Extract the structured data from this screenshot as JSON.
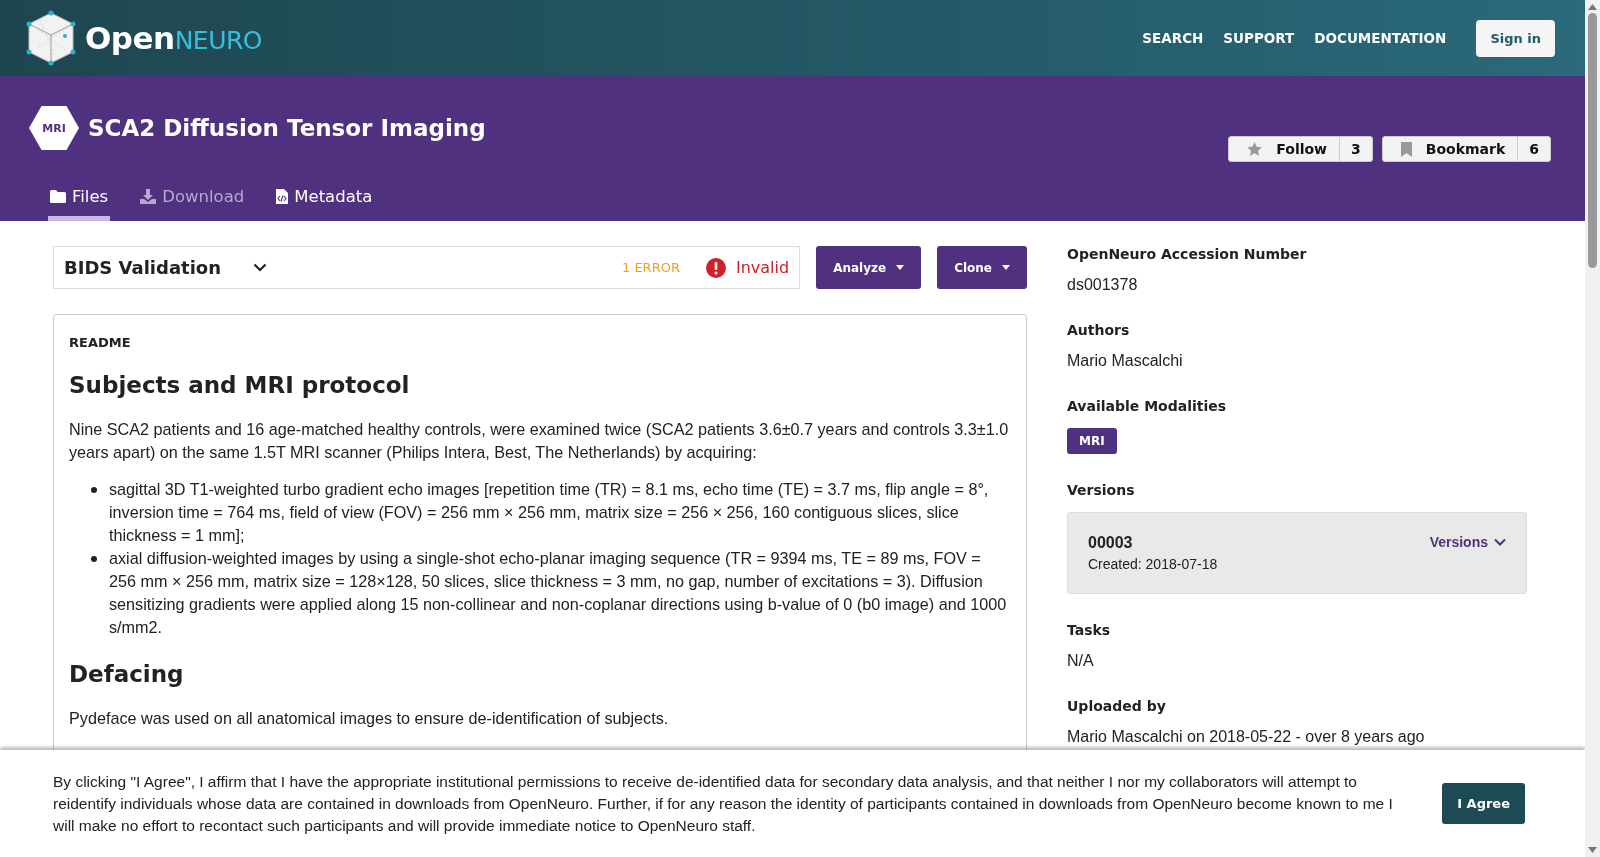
{
  "header": {
    "logo_text": "Open",
    "logo_accent": "NEURO",
    "nav": [
      "SEARCH",
      "SUPPORT",
      "DOCUMENTATION"
    ],
    "sign_in": "Sign in"
  },
  "dataset": {
    "modality_badge": "MRI",
    "title": "SCA2 Diffusion Tensor Imaging",
    "actions": [
      {
        "kind": "follow",
        "label": "Follow",
        "count": "3"
      },
      {
        "kind": "bookmark",
        "label": "Bookmark",
        "count": "6"
      }
    ],
    "tabs": [
      {
        "kind": "files",
        "label": "Files",
        "selected": true,
        "disabled": false
      },
      {
        "kind": "download",
        "label": "Download",
        "selected": false,
        "disabled": true
      },
      {
        "kind": "metadata",
        "label": "Metadata",
        "selected": false,
        "disabled": false
      }
    ]
  },
  "validation": {
    "title": "BIDS Validation",
    "error_count": "1 ERROR",
    "status": "Invalid"
  },
  "toolbar_buttons": [
    "Analyze",
    "Clone"
  ],
  "readme": {
    "label": "README",
    "blocks": [
      {
        "kind": "heading",
        "text": "Subjects and MRI protocol"
      },
      {
        "kind": "paragraph",
        "text": "Nine SCA2 patients and 16 age-matched healthy controls, were examined twice (SCA2 patients 3.6±0.7 years and controls 3.3±1.0 years apart) on the same 1.5T MRI scanner (Philips Intera, Best, The Netherlands) by acquiring:"
      },
      {
        "kind": "list",
        "items": [
          "sagittal 3D T1-weighted turbo gradient echo images [repetition time (TR) = 8.1 ms, echo time (TE) = 3.7 ms, flip angle = 8°, inversion time = 764 ms, field of view (FOV) = 256 mm × 256 mm, matrix size = 256 × 256, 160 contiguous slices, slice thickness = 1 mm];",
          "axial diffusion-weighted images by using a single-shot echo-planar imaging sequence (TR = 9394 ms, TE = 89 ms, FOV = 256 mm × 256 mm, matrix size = 128×128, 50 slices, slice thickness = 3 mm, no gap, number of excitations = 3). Diffusion sensitizing gradients were applied along 15 non-collinear and non-coplanar directions using b-value of 0 (b0 image) and 1000 s/mm2."
        ]
      },
      {
        "kind": "heading",
        "text": "Defacing"
      },
      {
        "kind": "paragraph",
        "text": "Pydeface was used on all anatomical images to ensure de-identification of subjects."
      }
    ]
  },
  "sidebar": [
    {
      "kind": "text",
      "label": "OpenNeuro Accession Number",
      "value": "ds001378"
    },
    {
      "kind": "text",
      "label": "Authors",
      "value": "Mario Mascalchi"
    },
    {
      "kind": "tags",
      "label": "Available Modalities",
      "tags": [
        "MRI"
      ]
    },
    {
      "kind": "version",
      "label": "Versions",
      "version": "00003",
      "created": "Created: 2018-07-18",
      "menu": "Versions"
    },
    {
      "kind": "text",
      "label": "Tasks",
      "value": "N/A"
    },
    {
      "kind": "text",
      "label": "Uploaded by",
      "value": "Mario Mascalchi on 2018-05-22 - over 8 years ago"
    }
  ],
  "consent": {
    "text": "By clicking \"I Agree\", I affirm that I have the appropriate institutional permissions to receive de-identified data for secondary data analysis, and that neither I nor my collaborators will attempt to reidentify individuals whose data are contained in downloads from OpenNeuro. Further, if for any reason the identity of participants contained in downloads from OpenNeuro become known to me I will make no effort to recontact such participants and will provide immediate notice to OpenNeuro staff.",
    "button": "I Agree"
  }
}
